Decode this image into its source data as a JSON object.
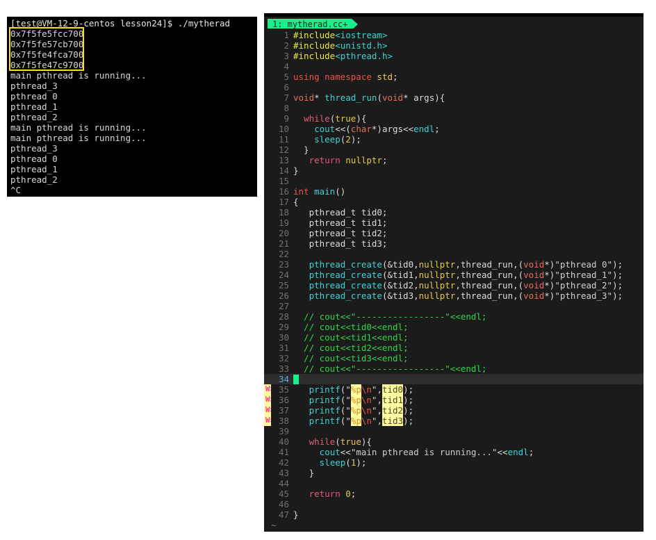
{
  "terminal": {
    "title": "shell-terminal",
    "prompt": "[test@VM-12-9-centos lesson24]$ ./mytherad",
    "lines": [
      "0x7f5fe5fcc700",
      "0x7f5fe57cb700",
      "0x7f5fe4fca700",
      "0x7f5fe47c9700",
      "main pthread is running...",
      "pthread_3",
      "pthread 0",
      "pthread_1",
      "pthread_2",
      "main pthread is running...",
      "main pthread is running...",
      "pthread_3",
      "pthread 0",
      "pthread_1",
      "pthread_2",
      "^C"
    ],
    "annotation_color": "#ffe300",
    "bg_color": "#000000",
    "fg_color": "#d8d8d8"
  },
  "editor": {
    "tab_label": "1: mytherad.cc+",
    "tab_color": "#19f08a",
    "bg_color": "#1b1b1b",
    "cursor_line": 34,
    "cursor_color": "#19f08a",
    "warn_marker": "W>",
    "warn_lines": [
      35,
      36,
      37,
      38
    ],
    "eof_marker": "~",
    "lines": [
      {
        "n": 1,
        "tokens": [
          {
            "t": "#include",
            "c": "c-pre"
          },
          {
            "t": "<iostream>",
            "c": "c-hdr"
          }
        ]
      },
      {
        "n": 2,
        "tokens": [
          {
            "t": "#include",
            "c": "c-pre"
          },
          {
            "t": "<unistd.h>",
            "c": "c-hdr"
          }
        ]
      },
      {
        "n": 3,
        "tokens": [
          {
            "t": "#include",
            "c": "c-pre"
          },
          {
            "t": "<pthread.h>",
            "c": "c-hdr"
          }
        ]
      },
      {
        "n": 4,
        "tokens": []
      },
      {
        "n": 5,
        "tokens": [
          {
            "t": "using namespace ",
            "c": "c-kw"
          },
          {
            "t": "std",
            "c": "c-std"
          },
          {
            "t": ";",
            "c": "c-op"
          }
        ]
      },
      {
        "n": 6,
        "tokens": []
      },
      {
        "n": 7,
        "tokens": [
          {
            "t": "void",
            "c": "c-kw2"
          },
          {
            "t": "* ",
            "c": "c-op"
          },
          {
            "t": "thread_run",
            "c": "c-fn"
          },
          {
            "t": "(",
            "c": "c-op"
          },
          {
            "t": "void",
            "c": "c-kw2"
          },
          {
            "t": "* args){",
            "c": "c-op"
          }
        ]
      },
      {
        "n": 8,
        "tokens": []
      },
      {
        "n": 9,
        "tokens": [
          {
            "t": "  ",
            "c": "c-op"
          },
          {
            "t": "while",
            "c": "c-ctrl"
          },
          {
            "t": "(",
            "c": "c-op"
          },
          {
            "t": "true",
            "c": "c-bool"
          },
          {
            "t": "){",
            "c": "c-op"
          }
        ]
      },
      {
        "n": 10,
        "tokens": [
          {
            "t": "    ",
            "c": "c-op"
          },
          {
            "t": "cout",
            "c": "c-endl"
          },
          {
            "t": "<<(",
            "c": "c-op"
          },
          {
            "t": "char",
            "c": "c-kw2"
          },
          {
            "t": "*)args",
            "c": "c-op"
          },
          {
            "t": "<<",
            "c": "c-op"
          },
          {
            "t": "endl",
            "c": "c-endl"
          },
          {
            "t": ";",
            "c": "c-op"
          }
        ]
      },
      {
        "n": 11,
        "tokens": [
          {
            "t": "    ",
            "c": "c-op"
          },
          {
            "t": "sleep",
            "c": "c-fn"
          },
          {
            "t": "(",
            "c": "c-op"
          },
          {
            "t": "2",
            "c": "c-num"
          },
          {
            "t": ");",
            "c": "c-op"
          }
        ]
      },
      {
        "n": 12,
        "tokens": [
          {
            "t": "  }",
            "c": "c-op"
          }
        ]
      },
      {
        "n": 13,
        "tokens": [
          {
            "t": "   ",
            "c": "c-op"
          },
          {
            "t": "return",
            "c": "c-ctrl"
          },
          {
            "t": " ",
            "c": "c-op"
          },
          {
            "t": "nullptr",
            "c": "c-null"
          },
          {
            "t": ";",
            "c": "c-op"
          }
        ]
      },
      {
        "n": 14,
        "tokens": [
          {
            "t": "}",
            "c": "c-op"
          }
        ]
      },
      {
        "n": 15,
        "tokens": []
      },
      {
        "n": 16,
        "tokens": [
          {
            "t": "int",
            "c": "c-kw"
          },
          {
            "t": " ",
            "c": "c-op"
          },
          {
            "t": "main",
            "c": "c-fn"
          },
          {
            "t": "()",
            "c": "c-op"
          }
        ]
      },
      {
        "n": 17,
        "tokens": [
          {
            "t": "{",
            "c": "c-op"
          }
        ]
      },
      {
        "n": 18,
        "tokens": [
          {
            "t": "   pthread_t tid0;",
            "c": "c-plain"
          }
        ]
      },
      {
        "n": 19,
        "tokens": [
          {
            "t": "   pthread_t tid1;",
            "c": "c-plain"
          }
        ]
      },
      {
        "n": 20,
        "tokens": [
          {
            "t": "   pthread_t tid2;",
            "c": "c-plain"
          }
        ]
      },
      {
        "n": 21,
        "tokens": [
          {
            "t": "   pthread_t tid3;",
            "c": "c-plain"
          }
        ]
      },
      {
        "n": 22,
        "tokens": []
      },
      {
        "n": 23,
        "tokens": [
          {
            "t": "   ",
            "c": "c-op"
          },
          {
            "t": "pthread_create",
            "c": "c-fn"
          },
          {
            "t": "(&tid0,",
            "c": "c-op"
          },
          {
            "t": "nullptr",
            "c": "c-null"
          },
          {
            "t": ",thread_run,(",
            "c": "c-op"
          },
          {
            "t": "void",
            "c": "c-kw2"
          },
          {
            "t": "*)",
            "c": "c-op"
          },
          {
            "t": "\"pthread 0\"",
            "c": "c-str"
          },
          {
            "t": ");",
            "c": "c-op"
          }
        ]
      },
      {
        "n": 24,
        "tokens": [
          {
            "t": "   ",
            "c": "c-op"
          },
          {
            "t": "pthread_create",
            "c": "c-fn"
          },
          {
            "t": "(&tid1,",
            "c": "c-op"
          },
          {
            "t": "nullptr",
            "c": "c-null"
          },
          {
            "t": ",thread_run,(",
            "c": "c-op"
          },
          {
            "t": "void",
            "c": "c-kw2"
          },
          {
            "t": "*)",
            "c": "c-op"
          },
          {
            "t": "\"pthread_1\"",
            "c": "c-str"
          },
          {
            "t": ");",
            "c": "c-op"
          }
        ]
      },
      {
        "n": 25,
        "tokens": [
          {
            "t": "   ",
            "c": "c-op"
          },
          {
            "t": "pthread_create",
            "c": "c-fn"
          },
          {
            "t": "(&tid2,",
            "c": "c-op"
          },
          {
            "t": "nullptr",
            "c": "c-null"
          },
          {
            "t": ",thread_run,(",
            "c": "c-op"
          },
          {
            "t": "void",
            "c": "c-kw2"
          },
          {
            "t": "*)",
            "c": "c-op"
          },
          {
            "t": "\"pthread_2\"",
            "c": "c-str"
          },
          {
            "t": ");",
            "c": "c-op"
          }
        ]
      },
      {
        "n": 26,
        "tokens": [
          {
            "t": "   ",
            "c": "c-op"
          },
          {
            "t": "pthread_create",
            "c": "c-fn"
          },
          {
            "t": "(&tid3,",
            "c": "c-op"
          },
          {
            "t": "nullptr",
            "c": "c-null"
          },
          {
            "t": ",thread_run,(",
            "c": "c-op"
          },
          {
            "t": "void",
            "c": "c-kw2"
          },
          {
            "t": "*)",
            "c": "c-op"
          },
          {
            "t": "\"pthread_3\"",
            "c": "c-str"
          },
          {
            "t": ");",
            "c": "c-op"
          }
        ]
      },
      {
        "n": 27,
        "tokens": []
      },
      {
        "n": 28,
        "tokens": [
          {
            "t": "  // cout<<\"-----------------\"<<endl;",
            "c": "c-cmt"
          }
        ]
      },
      {
        "n": 29,
        "tokens": [
          {
            "t": "  // cout<<tid0<<endl;",
            "c": "c-cmt"
          }
        ]
      },
      {
        "n": 30,
        "tokens": [
          {
            "t": "  // cout<<tid1<<endl;",
            "c": "c-cmt"
          }
        ]
      },
      {
        "n": 31,
        "tokens": [
          {
            "t": "  // cout<<tid2<<endl;",
            "c": "c-cmt"
          }
        ]
      },
      {
        "n": 32,
        "tokens": [
          {
            "t": "  // cout<<tid3<<endl;",
            "c": "c-cmt"
          }
        ]
      },
      {
        "n": 33,
        "tokens": [
          {
            "t": "  // cout<<\"-----------------\"<<endl;",
            "c": "c-cmt"
          }
        ]
      },
      {
        "n": 34,
        "tokens": [],
        "cursor": true
      },
      {
        "n": 35,
        "warn": true,
        "tokens": [
          {
            "t": "   ",
            "c": "c-op"
          },
          {
            "t": "printf",
            "c": "c-fn"
          },
          {
            "t": "(",
            "c": "c-op"
          },
          {
            "t": "\"",
            "c": "c-str"
          },
          {
            "t": "%p",
            "c": "c-fmt"
          },
          {
            "t": "\\n",
            "c": "c-esc"
          },
          {
            "t": "\",",
            "c": "c-str"
          },
          {
            "t": "tid0",
            "c": "c-hl"
          },
          {
            "t": ");",
            "c": "c-op"
          }
        ]
      },
      {
        "n": 36,
        "warn": true,
        "tokens": [
          {
            "t": "   ",
            "c": "c-op"
          },
          {
            "t": "printf",
            "c": "c-fn"
          },
          {
            "t": "(",
            "c": "c-op"
          },
          {
            "t": "\"",
            "c": "c-str"
          },
          {
            "t": "%p",
            "c": "c-fmt"
          },
          {
            "t": "\\n",
            "c": "c-esc"
          },
          {
            "t": "\",",
            "c": "c-str"
          },
          {
            "t": "tid1",
            "c": "c-hl"
          },
          {
            "t": ");",
            "c": "c-op"
          }
        ]
      },
      {
        "n": 37,
        "warn": true,
        "tokens": [
          {
            "t": "   ",
            "c": "c-op"
          },
          {
            "t": "printf",
            "c": "c-fn"
          },
          {
            "t": "(",
            "c": "c-op"
          },
          {
            "t": "\"",
            "c": "c-str"
          },
          {
            "t": "%p",
            "c": "c-fmt"
          },
          {
            "t": "\\n",
            "c": "c-esc"
          },
          {
            "t": "\",",
            "c": "c-str"
          },
          {
            "t": "tid2",
            "c": "c-hl"
          },
          {
            "t": ");",
            "c": "c-op"
          }
        ]
      },
      {
        "n": 38,
        "warn": true,
        "tokens": [
          {
            "t": "   ",
            "c": "c-op"
          },
          {
            "t": "printf",
            "c": "c-fn"
          },
          {
            "t": "(",
            "c": "c-op"
          },
          {
            "t": "\"",
            "c": "c-str"
          },
          {
            "t": "%p",
            "c": "c-fmt"
          },
          {
            "t": "\\n",
            "c": "c-esc"
          },
          {
            "t": "\",",
            "c": "c-str"
          },
          {
            "t": "tid3",
            "c": "c-hl"
          },
          {
            "t": ");",
            "c": "c-op"
          }
        ]
      },
      {
        "n": 39,
        "tokens": []
      },
      {
        "n": 40,
        "tokens": [
          {
            "t": "   ",
            "c": "c-op"
          },
          {
            "t": "while",
            "c": "c-ctrl"
          },
          {
            "t": "(",
            "c": "c-op"
          },
          {
            "t": "true",
            "c": "c-bool"
          },
          {
            "t": "){",
            "c": "c-op"
          }
        ]
      },
      {
        "n": 41,
        "tokens": [
          {
            "t": "     ",
            "c": "c-op"
          },
          {
            "t": "cout",
            "c": "c-endl"
          },
          {
            "t": "<<",
            "c": "c-op"
          },
          {
            "t": "\"main pthread is running...\"",
            "c": "c-str"
          },
          {
            "t": "<<",
            "c": "c-op"
          },
          {
            "t": "endl",
            "c": "c-endl"
          },
          {
            "t": ";",
            "c": "c-op"
          }
        ]
      },
      {
        "n": 42,
        "tokens": [
          {
            "t": "     ",
            "c": "c-op"
          },
          {
            "t": "sleep",
            "c": "c-fn"
          },
          {
            "t": "(",
            "c": "c-op"
          },
          {
            "t": "1",
            "c": "c-num"
          },
          {
            "t": ");",
            "c": "c-op"
          }
        ]
      },
      {
        "n": 43,
        "tokens": [
          {
            "t": "   }",
            "c": "c-op"
          }
        ]
      },
      {
        "n": 44,
        "tokens": []
      },
      {
        "n": 45,
        "tokens": [
          {
            "t": "   ",
            "c": "c-op"
          },
          {
            "t": "return",
            "c": "c-ctrl"
          },
          {
            "t": " ",
            "c": "c-op"
          },
          {
            "t": "0",
            "c": "c-num"
          },
          {
            "t": ";",
            "c": "c-op"
          }
        ]
      },
      {
        "n": 46,
        "tokens": []
      },
      {
        "n": 47,
        "tokens": [
          {
            "t": "}",
            "c": "c-op"
          }
        ]
      }
    ]
  }
}
